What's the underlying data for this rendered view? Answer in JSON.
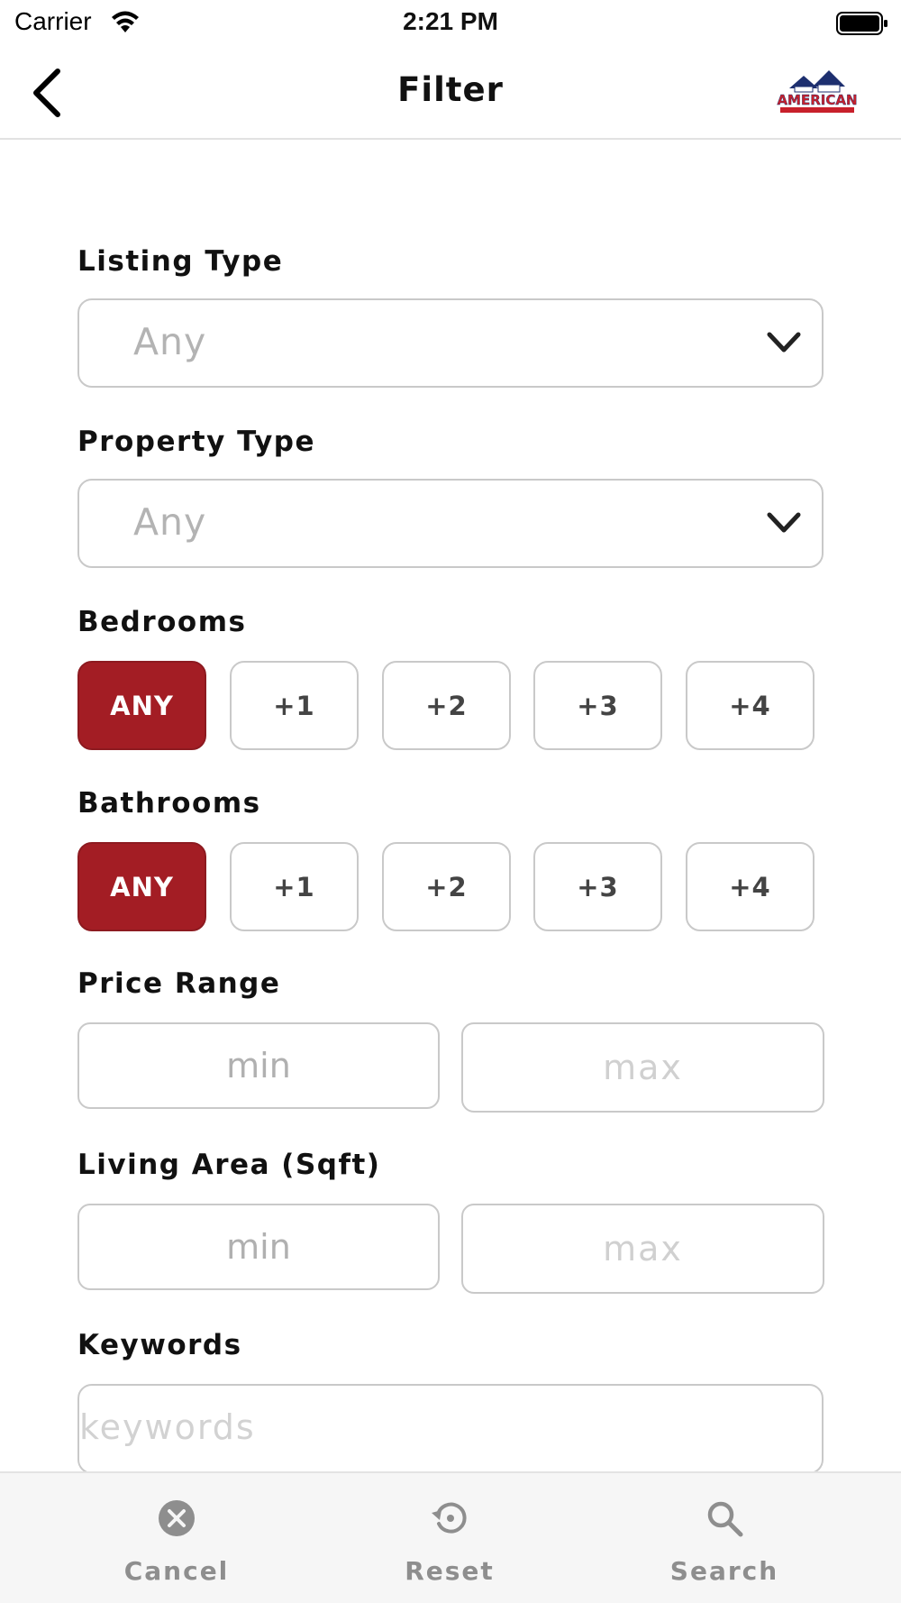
{
  "status_bar": {
    "carrier": "Carrier",
    "time": "2:21 PM",
    "icons": [
      "wifi-icon",
      "battery-icon"
    ]
  },
  "nav": {
    "title": "Filter",
    "back_icon": "chevron-left-icon",
    "logo_text": "AMERICAN"
  },
  "filters": {
    "listing_type": {
      "label": "Listing Type",
      "value": "Any"
    },
    "property_type": {
      "label": "Property Type",
      "value": "Any"
    },
    "bedrooms": {
      "label": "Bedrooms",
      "options": [
        "ANY",
        "+1",
        "+2",
        "+3",
        "+4"
      ],
      "selected": "ANY"
    },
    "bathrooms": {
      "label": "Bathrooms",
      "options": [
        "ANY",
        "+1",
        "+2",
        "+3",
        "+4"
      ],
      "selected": "ANY"
    },
    "price_range": {
      "label": "Price Range",
      "min_placeholder": "min",
      "max_placeholder": "max"
    },
    "living_area": {
      "label": "Living Area (Sqft)",
      "min_placeholder": "min",
      "max_placeholder": "max"
    },
    "keywords": {
      "label": "Keywords",
      "placeholder": "keywords"
    }
  },
  "tab_bar": {
    "items": [
      {
        "label": "Cancel",
        "icon": "close-circle-icon"
      },
      {
        "label": "Reset",
        "icon": "reset-icon"
      },
      {
        "label": "Search",
        "icon": "search-icon"
      }
    ]
  },
  "colors": {
    "accent": "#a31d24",
    "border": "#c9c9c9",
    "placeholder": "#b3b3b3",
    "tab_bar_bg": "#f6f6f6",
    "tab_label": "#8e8e8e"
  }
}
